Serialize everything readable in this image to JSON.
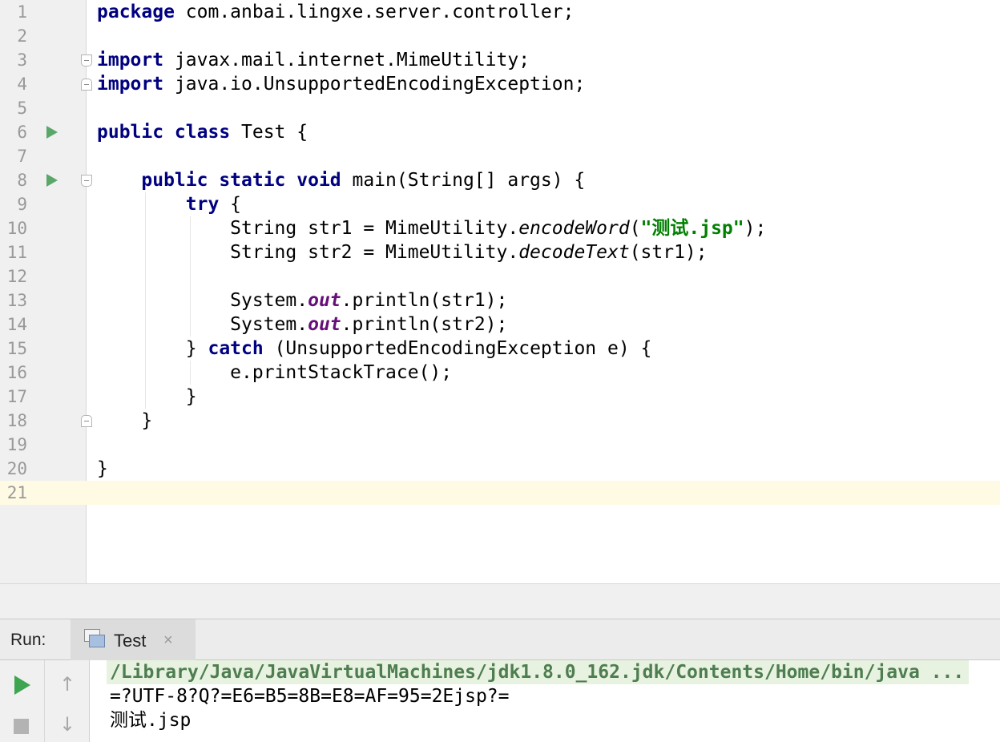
{
  "editor": {
    "current_line": 21,
    "lines": [
      {
        "num": "1",
        "code": "<span class=\"kw\">package</span> com.anbai.lingxe.server.controller;"
      },
      {
        "num": "2",
        "code": ""
      },
      {
        "num": "3",
        "code": "<span class=\"kw\">import</span> javax.mail.internet.MimeUtility;"
      },
      {
        "num": "4",
        "code": "<span class=\"kw\">import</span> java.io.UnsupportedEncodingException;"
      },
      {
        "num": "5",
        "code": ""
      },
      {
        "num": "6",
        "code": "<span class=\"kw\">public class</span> Test {"
      },
      {
        "num": "7",
        "code": ""
      },
      {
        "num": "8",
        "code": "    <span class=\"kw\">public static void</span> main(String[] args) {"
      },
      {
        "num": "9",
        "code": "        <span class=\"kw\">try</span> {"
      },
      {
        "num": "10",
        "code": "            String str1 = MimeUtility.<span class=\"static-method\">encodeWord</span>(<span class=\"str\">\"测试.jsp\"</span>);"
      },
      {
        "num": "11",
        "code": "            String str2 = MimeUtility.<span class=\"static-method\">decodeText</span>(str1);"
      },
      {
        "num": "12",
        "code": ""
      },
      {
        "num": "13",
        "code": "            System.<span class=\"static-field\">out</span>.println(str1);"
      },
      {
        "num": "14",
        "code": "            System.<span class=\"static-field\">out</span>.println(str2);"
      },
      {
        "num": "15",
        "code": "        } <span class=\"kw\">catch</span> (UnsupportedEncodingException e) {"
      },
      {
        "num": "16",
        "code": "            e.printStackTrace();"
      },
      {
        "num": "17",
        "code": "        }"
      },
      {
        "num": "18",
        "code": "    }"
      },
      {
        "num": "19",
        "code": ""
      },
      {
        "num": "20",
        "code": "}"
      },
      {
        "num": "21",
        "code": ""
      }
    ],
    "colors": {
      "keyword": "#000080",
      "string": "#008000",
      "static_field": "#660e7a",
      "current_line": "#fffae3",
      "run_icon": "#59a869"
    }
  },
  "run_panel": {
    "label": "Run:",
    "tab": {
      "icon": "console-icon",
      "label": "Test",
      "close": "×"
    },
    "toolbar": {
      "rerun_icon": "play-icon",
      "stop_icon": "stop-icon",
      "up": "↑",
      "down": "↓"
    },
    "console": {
      "command": "/Library/Java/JavaVirtualMachines/jdk1.8.0_162.jdk/Contents/Home/bin/java ...",
      "output": [
        "=?UTF-8?Q?=E6=B5=8B=E8=AF=95=2Ejsp?=",
        "测试.jsp"
      ]
    }
  }
}
